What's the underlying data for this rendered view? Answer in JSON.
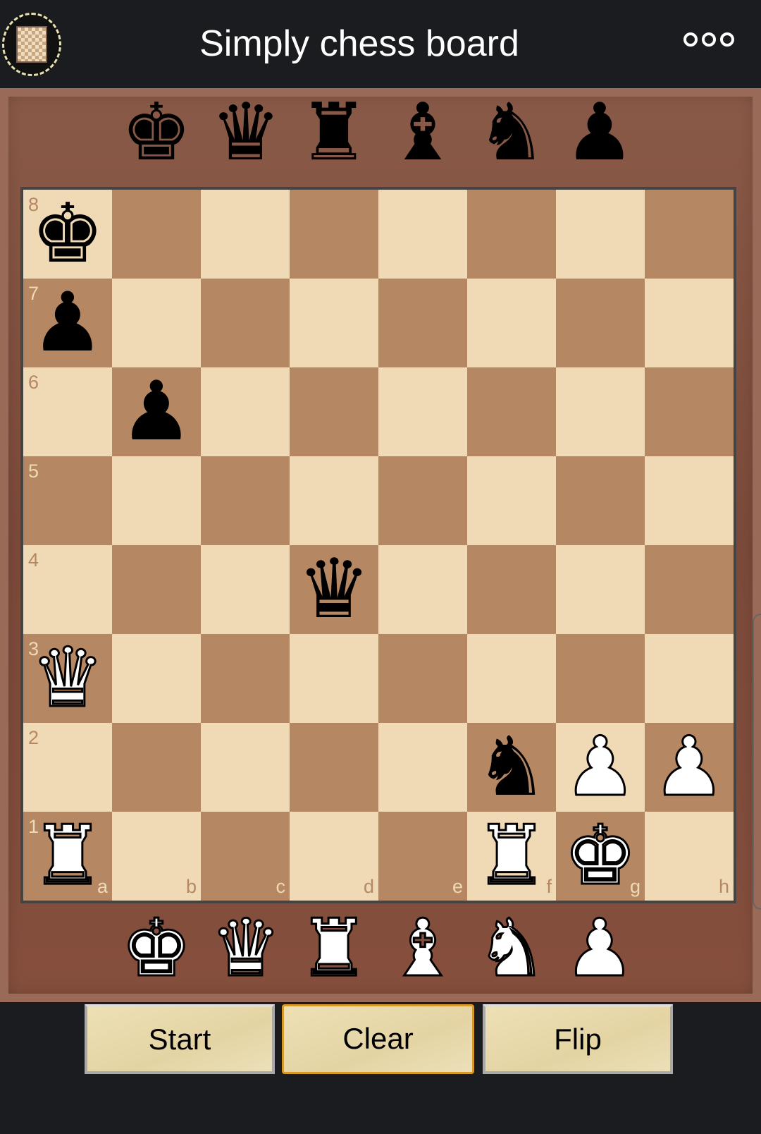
{
  "header": {
    "title": "Simply chess board",
    "logo": "app-logo",
    "menu_icon": "more-options-icon"
  },
  "colors": {
    "light_square": "#f0d9b5",
    "dark_square": "#b58863",
    "button_active_border": "#d79a28"
  },
  "tray_top": [
    {
      "piece": "king",
      "color": "black",
      "glyph": "♚"
    },
    {
      "piece": "queen",
      "color": "black",
      "glyph": "♛"
    },
    {
      "piece": "rook",
      "color": "black",
      "glyph": "♜"
    },
    {
      "piece": "bishop",
      "color": "black",
      "glyph": "♝"
    },
    {
      "piece": "knight",
      "color": "black",
      "glyph": "♞"
    },
    {
      "piece": "pawn",
      "color": "black",
      "glyph": "♟"
    }
  ],
  "tray_bottom": [
    {
      "piece": "king",
      "color": "white",
      "glyph": "♚"
    },
    {
      "piece": "queen",
      "color": "white",
      "glyph": "♛"
    },
    {
      "piece": "rook",
      "color": "white",
      "glyph": "♜"
    },
    {
      "piece": "bishop",
      "color": "white",
      "glyph": "♝"
    },
    {
      "piece": "knight",
      "color": "white",
      "glyph": "♞"
    },
    {
      "piece": "pawn",
      "color": "white",
      "glyph": "♟"
    }
  ],
  "board": {
    "files": [
      "a",
      "b",
      "c",
      "d",
      "e",
      "f",
      "g",
      "h"
    ],
    "ranks": [
      "8",
      "7",
      "6",
      "5",
      "4",
      "3",
      "2",
      "1"
    ],
    "pieces": [
      {
        "square": "a8",
        "piece": "king",
        "color": "black",
        "glyph": "♚"
      },
      {
        "square": "a7",
        "piece": "pawn",
        "color": "black",
        "glyph": "♟"
      },
      {
        "square": "b6",
        "piece": "pawn",
        "color": "black",
        "glyph": "♟"
      },
      {
        "square": "d4",
        "piece": "queen",
        "color": "black",
        "glyph": "♛"
      },
      {
        "square": "a3",
        "piece": "queen",
        "color": "white",
        "glyph": "♛"
      },
      {
        "square": "f2",
        "piece": "knight",
        "color": "black",
        "glyph": "♞"
      },
      {
        "square": "g2",
        "piece": "pawn",
        "color": "white",
        "glyph": "♟"
      },
      {
        "square": "h2",
        "piece": "pawn",
        "color": "white",
        "glyph": "♟"
      },
      {
        "square": "a1",
        "piece": "rook",
        "color": "white",
        "glyph": "♜"
      },
      {
        "square": "f1",
        "piece": "rook",
        "color": "white",
        "glyph": "♜"
      },
      {
        "square": "g1",
        "piece": "king",
        "color": "white",
        "glyph": "♚"
      }
    ]
  },
  "buttons": {
    "start": "Start",
    "clear": "Clear",
    "flip": "Flip"
  }
}
